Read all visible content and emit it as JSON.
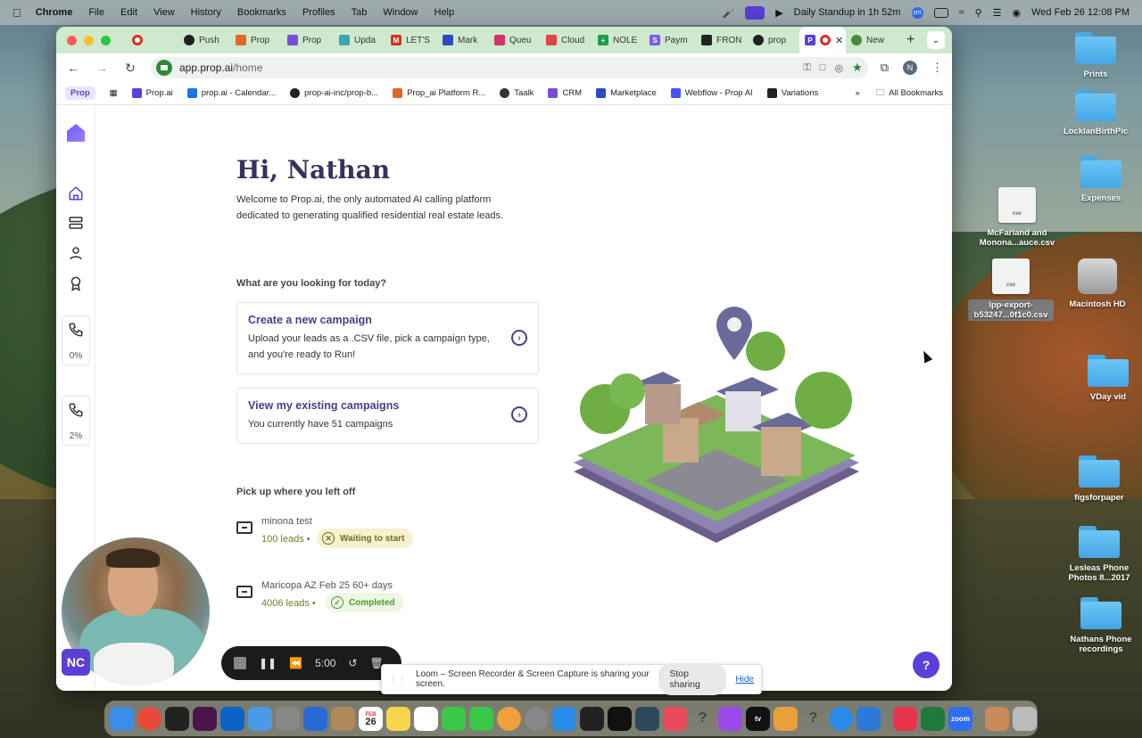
{
  "menubar": {
    "app": "Chrome",
    "items": [
      "File",
      "Edit",
      "View",
      "History",
      "Bookmarks",
      "Profiles",
      "Tab",
      "Window",
      "Help"
    ],
    "meeting": "Daily Standup in 1h 52m",
    "clock": "Wed Feb 26  12:08 PM"
  },
  "desktop": {
    "icons": [
      {
        "label": "Prints",
        "type": "folder"
      },
      {
        "label": "LocklanBirthPic",
        "type": "folder"
      },
      {
        "label": "Expenses",
        "type": "folder"
      },
      {
        "label": "McFarland and Monona...auce.csv",
        "type": "csv"
      },
      {
        "label": "lpp-export-b53247...0f1c0.csv",
        "type": "csv"
      },
      {
        "label": "Macintosh HD",
        "type": "disk"
      },
      {
        "label": "VDay vid",
        "type": "folder"
      },
      {
        "label": "figsforpaper",
        "type": "folder"
      },
      {
        "label": "Lesleas Phone Photos 8...2017",
        "type": "folder"
      },
      {
        "label": "Nathans Phone recordings",
        "type": "folder"
      }
    ],
    "csv_tag": "csv"
  },
  "browser": {
    "tabs": [
      {
        "label": "Push",
        "color": "#222222"
      },
      {
        "label": "Prop",
        "color": "#e0662a"
      },
      {
        "label": "Prop",
        "color": "#7b4dd6"
      },
      {
        "label": "Upda",
        "color": "#3aa7b8"
      },
      {
        "label": "LET'S",
        "color": "#d93025"
      },
      {
        "label": "Mark",
        "color": "#2b4bbf"
      },
      {
        "label": "Queu",
        "color": "#d6336c"
      },
      {
        "label": "Cloud",
        "color": "#e0434a"
      },
      {
        "label": "NOLE",
        "color": "#1e9e4a"
      },
      {
        "label": "Paym",
        "color": "#7a5af8"
      },
      {
        "label": "FRON",
        "color": "#222222"
      },
      {
        "label": "prop",
        "color": "#222222"
      },
      {
        "label": "New",
        "color": "#4a8a3a"
      }
    ],
    "active_tab_icon": "P",
    "url_host": "app.prop.ai",
    "url_path": "/home",
    "profile_initial": "N",
    "bookmarks": [
      {
        "label": "Prop.ai",
        "color": "#5b3fd6"
      },
      {
        "label": "prop.ai - Calendar...",
        "color": "#1a73e8"
      },
      {
        "label": "prop-ai-inc/prop-b...",
        "color": "#222222"
      },
      {
        "label": "Prop_ai Platform R...",
        "color": "#e0662a"
      },
      {
        "label": "Taalk",
        "color": "#333333"
      },
      {
        "label": "CRM",
        "color": "#7b4dd6"
      },
      {
        "label": "Marketplace",
        "color": "#2b4bbf"
      },
      {
        "label": "Webflow - Prop AI",
        "color": "#4353ff"
      },
      {
        "label": "Variations",
        "color": "#222222"
      }
    ],
    "bookmark_prop": "Prop",
    "all_bookmarks": "All Bookmarks"
  },
  "app": {
    "greeting": "Hi, Nathan",
    "welcome": "Welcome to Prop.ai, the only automated AI calling platform dedicated to generating qualified residential real estate leads.",
    "question": "What are you looking for today?",
    "cards": [
      {
        "title": "Create a new campaign",
        "desc": "Upload your leads as a .CSV file, pick a campaign type, and you're ready to Run!"
      },
      {
        "title": "View my existing campaigns",
        "desc": "You currently have 51 campaigns"
      }
    ],
    "pickup_title": "Pick up where you left off",
    "campaigns": [
      {
        "name": "minona test",
        "leads": "100 leads",
        "status": "Waiting to start"
      },
      {
        "name": "Maricopa AZ Feb 25 60+ days",
        "leads": "4006 leads",
        "status": "Completed"
      }
    ],
    "dial_stats": [
      "0%",
      "2%"
    ],
    "help": "?"
  },
  "loom": {
    "timer": "5:00",
    "sharing_text": "Loom – Screen Recorder & Screen Capture is sharing your screen.",
    "stop_sharing": "Stop sharing",
    "hide": "Hide"
  },
  "webcam_badge": "NC",
  "dock": {
    "calendar_day": "26",
    "calendar_month": "FEB"
  },
  "colors": {
    "brand": "#5b3fd6",
    "heading": "#3b2f5e",
    "card_title": "#4a3d8c",
    "tabbar": "#cfe9cf"
  }
}
